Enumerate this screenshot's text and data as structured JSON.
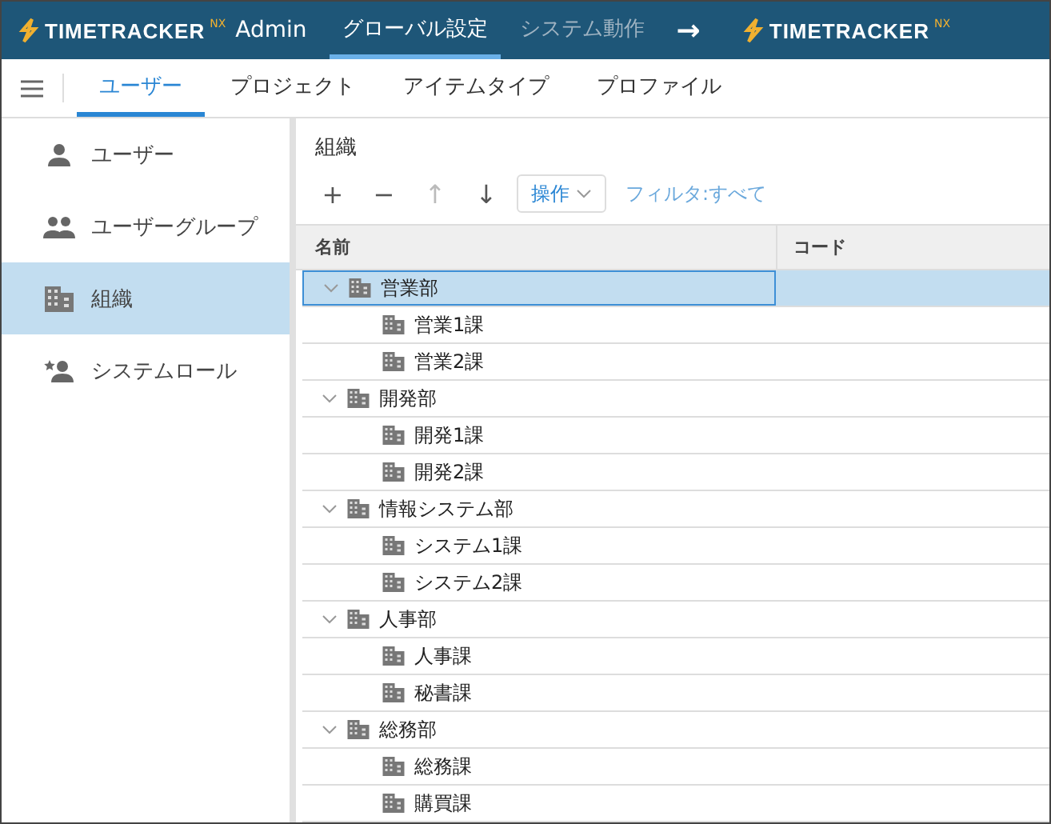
{
  "header": {
    "logo": {
      "brand": "TIMETRACKER",
      "suffix": "NX",
      "product": "Admin"
    },
    "tabs": [
      {
        "label": "グローバル設定",
        "selected": true
      },
      {
        "label": "システム動作",
        "selected": false
      }
    ],
    "arrow": "→",
    "link_logo": {
      "brand": "TIMETRACKER",
      "suffix": "NX"
    }
  },
  "subnav": {
    "tabs": [
      {
        "label": "ユーザー",
        "selected": true
      },
      {
        "label": "プロジェクト",
        "selected": false
      },
      {
        "label": "アイテムタイプ",
        "selected": false
      },
      {
        "label": "プロファイル",
        "selected": false
      }
    ]
  },
  "sidebar": {
    "items": [
      {
        "label": "ユーザー",
        "kind": "user",
        "selected": false
      },
      {
        "label": "ユーザーグループ",
        "kind": "group",
        "selected": false
      },
      {
        "label": "組織",
        "kind": "org",
        "selected": true
      },
      {
        "label": "システムロール",
        "kind": "role",
        "selected": false
      }
    ]
  },
  "main": {
    "title": "組織",
    "toolbar": {
      "add": "+",
      "remove": "−",
      "up": "↑",
      "down": "↓",
      "up_disabled": true,
      "actions": "操作",
      "filter": "フィルタ:すべて"
    },
    "table": {
      "columns": [
        "名前",
        "コード"
      ],
      "rows": [
        {
          "name": "営業部",
          "expanded": true,
          "selected": true,
          "children": [
            {
              "name": "営業1課",
              "selected": false
            },
            {
              "name": "営業2課",
              "selected": false
            }
          ]
        },
        {
          "name": "開発部",
          "expanded": true,
          "selected": false,
          "children": [
            {
              "name": "開発1課",
              "selected": false
            },
            {
              "name": "開発2課",
              "selected": false
            }
          ]
        },
        {
          "name": "情報システム部",
          "expanded": true,
          "selected": false,
          "children": [
            {
              "name": "システム1課",
              "selected": false
            },
            {
              "name": "システム2課",
              "selected": false
            }
          ]
        },
        {
          "name": "人事部",
          "expanded": true,
          "selected": false,
          "children": [
            {
              "name": "人事課",
              "selected": false
            },
            {
              "name": "秘書課",
              "selected": false
            }
          ]
        },
        {
          "name": "総務部",
          "expanded": true,
          "selected": false,
          "children": [
            {
              "name": "総務課",
              "selected": false
            },
            {
              "name": "購買課",
              "selected": false
            }
          ]
        }
      ]
    }
  }
}
